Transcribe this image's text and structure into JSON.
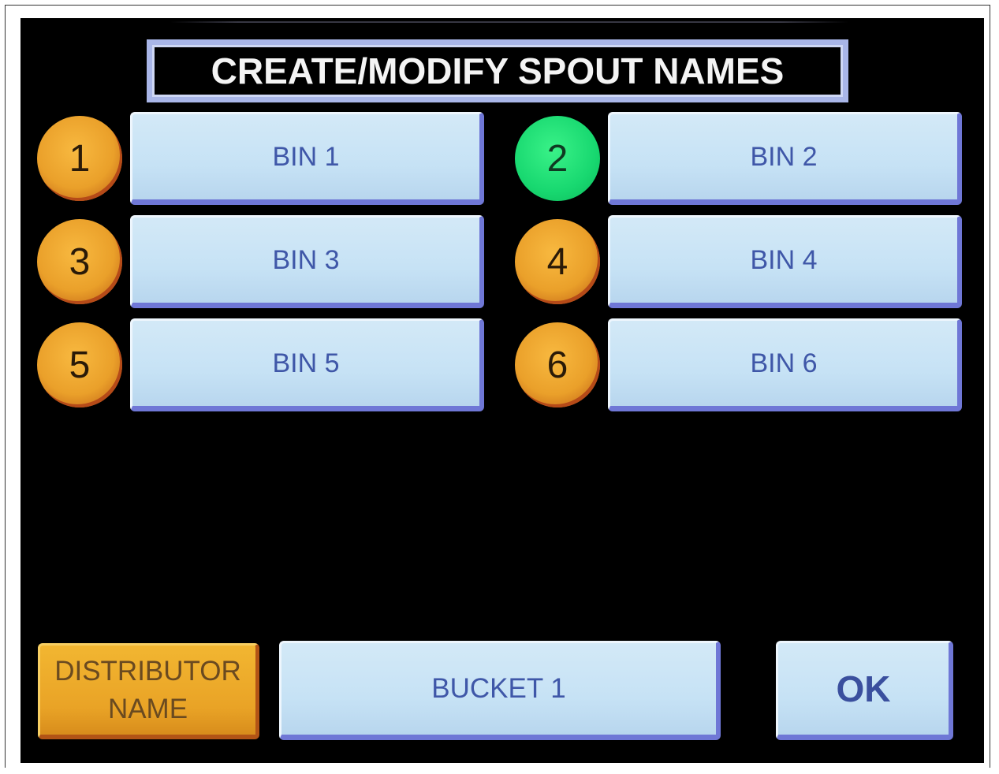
{
  "screen": {
    "title": "CREATE/MODIFY SPOUT NAMES"
  },
  "spouts": [
    {
      "number": "1",
      "name": "BIN 1",
      "status": "orange"
    },
    {
      "number": "2",
      "name": "BIN 2",
      "status": "green"
    },
    {
      "number": "3",
      "name": "BIN 3",
      "status": "orange"
    },
    {
      "number": "4",
      "name": "BIN 4",
      "status": "orange"
    },
    {
      "number": "5",
      "name": "BIN 5",
      "status": "orange"
    },
    {
      "number": "6",
      "name": "BIN 6",
      "status": "orange"
    }
  ],
  "footer": {
    "distributor_label_line1": "DISTRIBUTOR",
    "distributor_label_line2": "NAME",
    "distributor_name": "BUCKET 1",
    "ok_label": "OK"
  },
  "colors": {
    "badge_orange": "#eaa02a",
    "badge_green": "#18d870",
    "button_face": "#c6e2f5",
    "button_shadow": "#6f77d6",
    "screen_background": "#000000"
  }
}
